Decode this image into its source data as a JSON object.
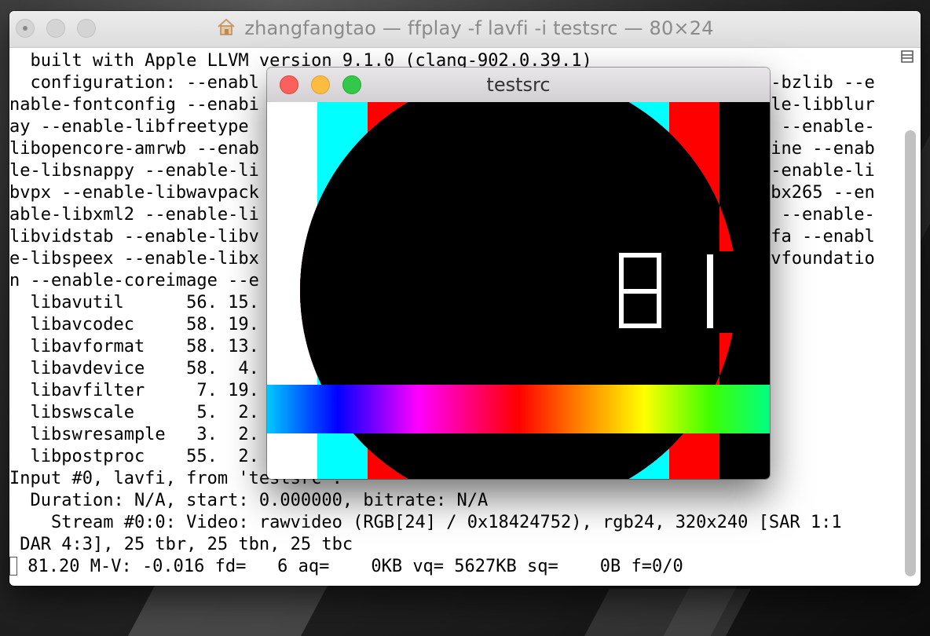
{
  "terminal": {
    "title": "zhangfangtao — ffplay -f lavfi -i testsrc — 80×24",
    "lines": [
      "  built with Apple LLVM version 9.1.0 (clang-902.0.39.1)",
      "  configuration: --enabl",
      "nable-fontconfig --enabi",
      "ay --enable-libfreetype",
      "libopencore-amrwb --enab",
      "le-libsnappy --enable-li",
      "bvpx --enable-libwavpack",
      "able-libxml2 --enable-li",
      "libvidstab --enable-libv",
      "e-libspeex --enable-libx",
      "n --enable-coreimage --e",
      "  libavutil      56. 15.",
      "  libavcodec     58. 19.",
      "  libavformat    58. 13.",
      "  libavdevice    58.  4.",
      "  libavfilter     7. 19.",
      "  libswscale      5.  2.",
      "  libswresample   3.  2.",
      "  libpostproc    55.  2.",
      "Input #0, lavfi, from 'testsrc':",
      "  Duration: N/A, start: 0.000000, bitrate: N/A",
      "    Stream #0:0: Video: rawvideo (RGB[24] / 0x18424752), rgb24, 320x240 [SAR 1:1",
      " DAR 4:3], 25 tbr, 25 tbn, 25 tbc",
      " 81.20 M-V: -0.016 fd=   6 aq=    0KB vq= 5627KB sq=    0B f=0/0"
    ],
    "right_fragments": [
      "e-bzlib --e",
      "ble-libblur",
      "b --enable-",
      "hine --enab",
      "--enable-li",
      "ibx265 --en",
      "p --enable-",
      "ofa --enabl",
      "avfoundatio"
    ]
  },
  "player": {
    "title": "testsrc",
    "counter": "81",
    "bars": [
      "#000000",
      "#ff0000",
      "#00ffff",
      "#ff00ff",
      "#0000ff",
      "#ffff00",
      "#00ff00",
      "#ff0000",
      "#00ffff",
      "#ffffff"
    ]
  },
  "colors": {
    "close": "#fc605c",
    "minimize": "#fdbc40",
    "zoom": "#34c84a"
  },
  "icons": {
    "title_icon": "home-icon",
    "scroll_toggle": "scroll-toggle-icon"
  }
}
